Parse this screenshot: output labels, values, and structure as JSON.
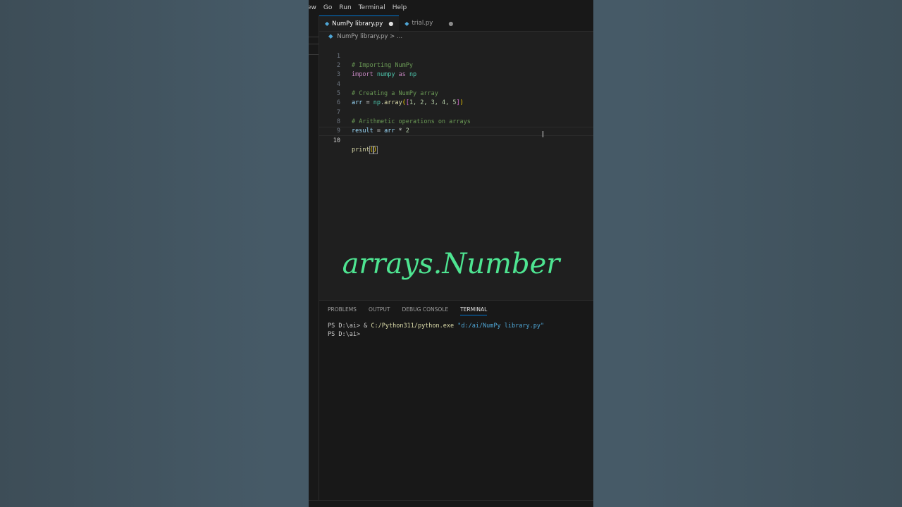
{
  "menu": [
    "ew",
    "Go",
    "Run",
    "Terminal",
    "Help"
  ],
  "tabs": [
    {
      "label": "NumPy library.py",
      "modified": "●"
    },
    {
      "label": "trial.py",
      "modified": "●"
    }
  ],
  "breadcrumb": {
    "file": "NumPy library.py",
    "sep": ">",
    "more": "..."
  },
  "code": {
    "line_numbers": [
      "1",
      "2",
      "3",
      "4",
      "5",
      "6",
      "7",
      "8",
      "9",
      "10"
    ],
    "l1": "# Importing NumPy",
    "l2_kw1": "import",
    "l2_mod": "numpy",
    "l2_kw2": "as",
    "l2_alias": "np",
    "l4": "# Creating a NumPy array",
    "l5_var": "arr",
    "l5_eq": " = ",
    "l5_mod": "np",
    "l5_dot": ".",
    "l5_fn": "array",
    "l5_open1": "(",
    "l5_open2": "[",
    "l5_nums": "1, 2, 3, 4, 5",
    "l5_close2": "]",
    "l5_close1": ")",
    "l7": "# Arithmetic operations on arrays",
    "l8_var": "result",
    "l8_eq": " = ",
    "l8_var2": "arr",
    "l8_op": " * ",
    "l8_num": "2",
    "l10_fn": "print",
    "l10_open": "(",
    "l10_close": ")"
  },
  "overlay_text": "arrays.Number",
  "panel": {
    "tabs": [
      "PROBLEMS",
      "OUTPUT",
      "DEBUG CONSOLE",
      "TERMINAL"
    ],
    "active_tab": "TERMINAL",
    "line1_prompt": "PS D:\\ai> & ",
    "line1_cmd": "C:/Python311/python.exe",
    "line1_arg": " \"d:/ai/NumPy library.py\"",
    "line2_prompt": "PS D:\\ai> "
  },
  "colors": {
    "overlay": "#4ee491",
    "accent": "#0078d4"
  }
}
